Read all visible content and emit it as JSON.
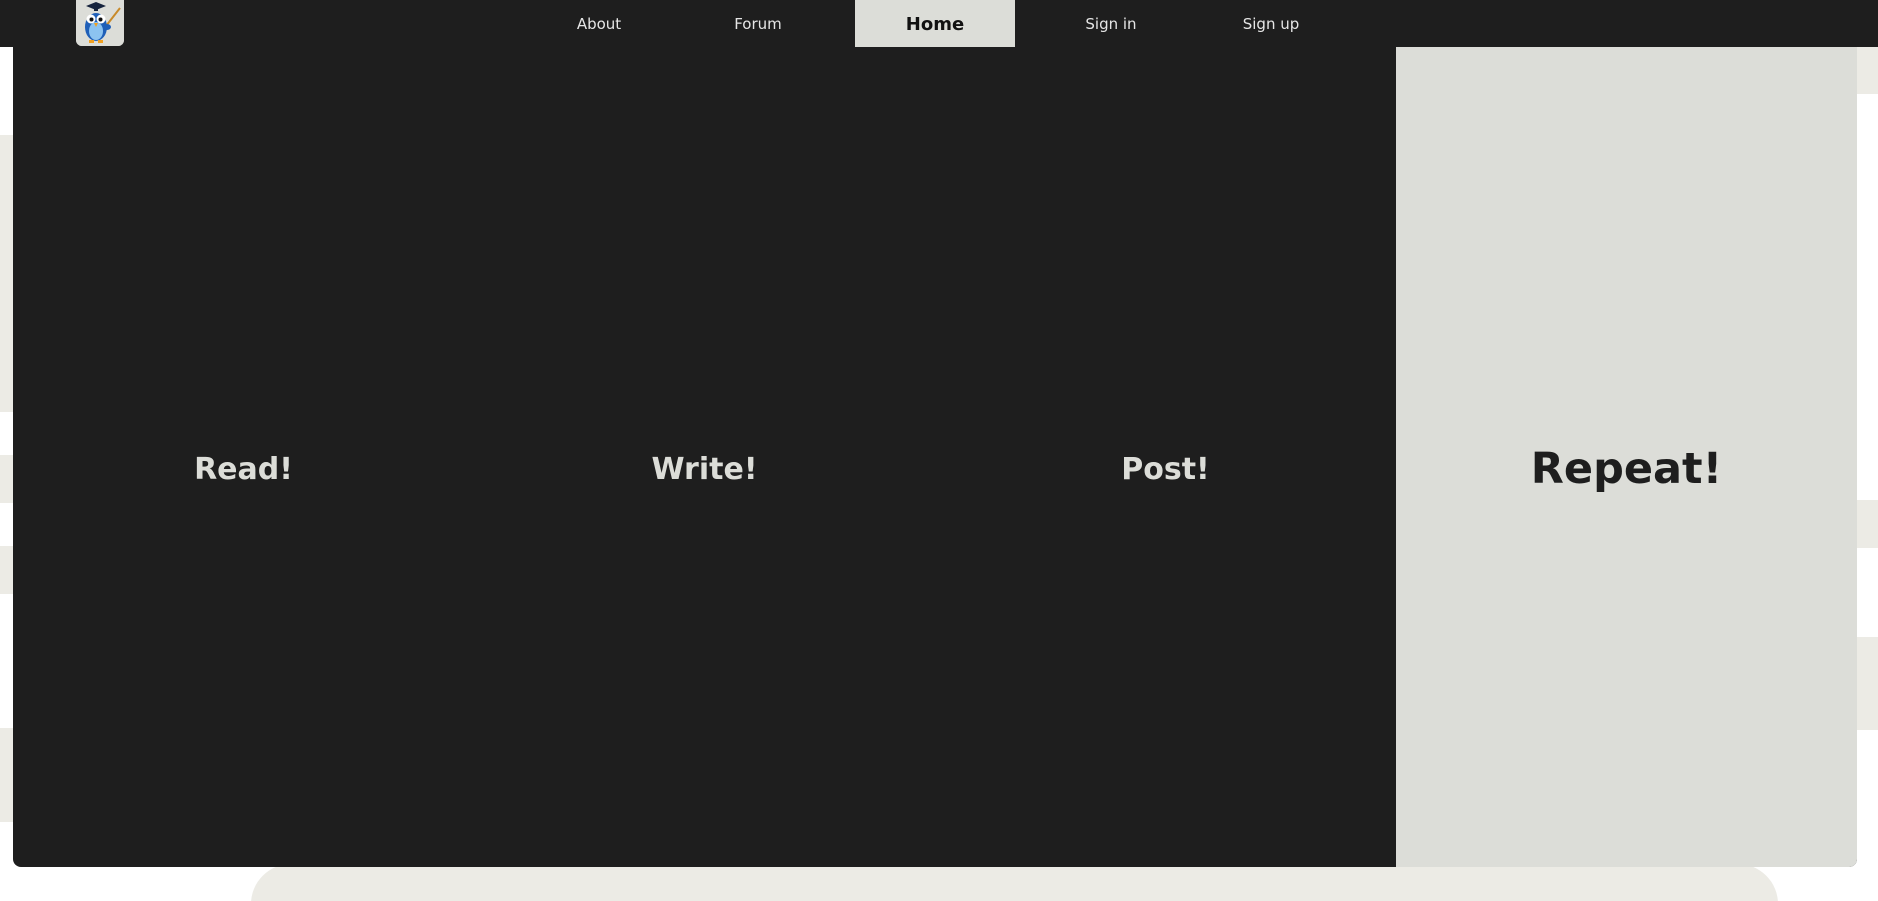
{
  "nav": {
    "logo_alt": "owl-mascot-logo",
    "items": [
      {
        "label": "About"
      },
      {
        "label": "Forum"
      },
      {
        "label": "Home",
        "active": true
      },
      {
        "label": "Sign in"
      },
      {
        "label": "Sign up"
      }
    ]
  },
  "hero": {
    "columns": [
      {
        "label": "Read!"
      },
      {
        "label": "Write!"
      },
      {
        "label": "Post!"
      },
      {
        "label": "Repeat!",
        "highlighted": true
      }
    ]
  },
  "colors": {
    "dark": "#1e1e1e",
    "light": "#dcddd8",
    "accent_bg": "#ecebe5",
    "logo_blue": "#1f5fb8"
  }
}
